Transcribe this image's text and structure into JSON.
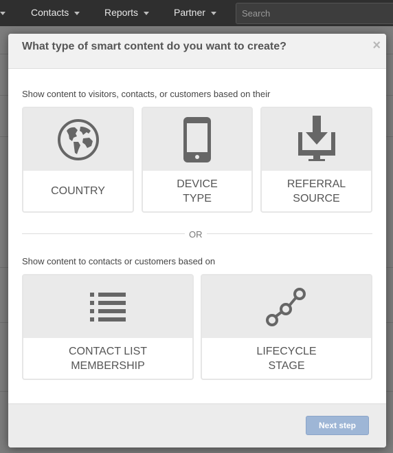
{
  "nav": {
    "items": [
      {
        "label": "Contacts"
      },
      {
        "label": "Reports"
      },
      {
        "label": "Partner"
      }
    ],
    "search_placeholder": "Search"
  },
  "modal": {
    "title": "What type of smart content do you want to create?",
    "close_icon": "×",
    "prompt_visitors": "Show content to visitors, contacts, or customers based on their",
    "or_text": "OR",
    "prompt_contacts": "Show content to contacts or customers based on",
    "options_visitors": [
      {
        "label": "COUNTRY",
        "icon": "globe-icon"
      },
      {
        "label": "DEVICE\nTYPE",
        "icon": "smartphone-icon"
      },
      {
        "label": "REFERRAL\nSOURCE",
        "icon": "download-monitor-icon"
      }
    ],
    "options_contacts": [
      {
        "label": "CONTACT LIST\nMEMBERSHIP",
        "icon": "list-icon"
      },
      {
        "label": "LIFECYCLE\nSTAGE",
        "icon": "stage-path-icon"
      }
    ],
    "next_button": "Next step"
  },
  "colors": {
    "header_bg": "#f1f1f1",
    "icon_gray": "#666666",
    "primary_disabled": "#9eb6d6"
  }
}
